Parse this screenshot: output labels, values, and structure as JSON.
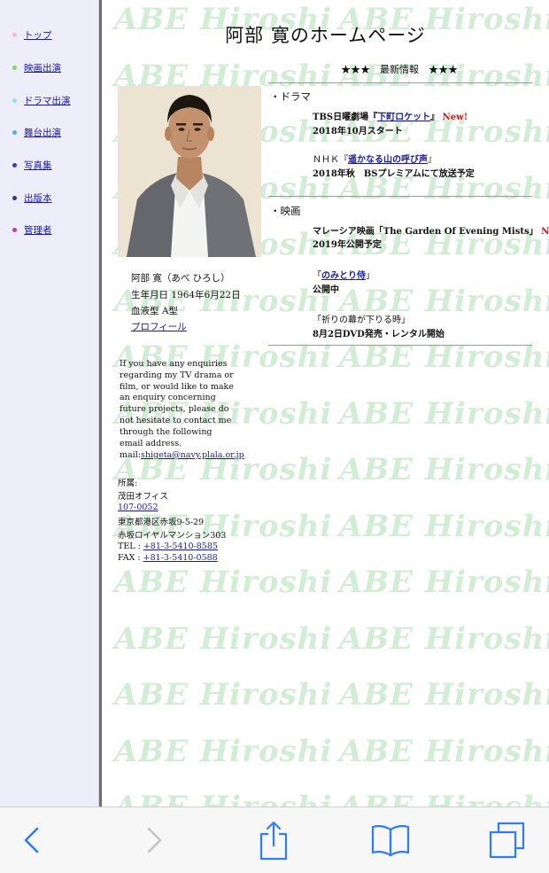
{
  "sidebar": {
    "items": [
      {
        "label": "トップ",
        "color": "#f3b9c8"
      },
      {
        "label": "映画出演",
        "color": "#7ed66a"
      },
      {
        "label": "ドラマ出演",
        "color": "#8fe3ea"
      },
      {
        "label": "舞台出演",
        "color": "#5aa7e6"
      },
      {
        "label": "写真集",
        "color": "#3a3fa8"
      },
      {
        "label": "出版本",
        "color": "#34309a"
      },
      {
        "label": "管理者",
        "color": "#b040c8"
      }
    ]
  },
  "watermark": {
    "text": "ABE Hiroshi",
    "color": "#d2ecd6"
  },
  "header": {
    "title": "阿部 寛のホームページ",
    "news_title": "★★★　最新情報　★★★"
  },
  "profile": {
    "name": "阿部 寛（あべ ひろし）",
    "birth": "生年月日 1964年6月22日",
    "blood": "血液型 A型",
    "link_label": "プロフィール"
  },
  "news": {
    "drama": {
      "heading": "・ドラマ",
      "item1_prefix": "TBS日曜劇場『",
      "item1_link": "下町ロケット",
      "item1_suffix": "』",
      "item1_badge": "New!",
      "item1_sub": "2018年10月スタート",
      "item2_prefix": "ＮＨＫ『",
      "item2_link": "遥かなる山の呼び声",
      "item2_suffix": "』",
      "item2_sub": "2018年秋　BSプレミアムにて放送予定"
    },
    "movie": {
      "heading": "・映画",
      "item1_prefix": "マレーシア映画「The Garden Of Evening Mists」",
      "item1_badge": "New!",
      "item1_sub": "2019年公開予定",
      "item2_prefix": "「",
      "item2_link": "のみとり侍",
      "item2_suffix": "」",
      "item2_sub": "公開中",
      "item3_title": "「祈りの幕が下りる時」",
      "item3_sub": "8月2日DVD発売・レンタル開始"
    }
  },
  "contact": {
    "enquiry": "If you have any enquiries regarding my TV drama or film, or would like to make an enquiry concerning future projects, please do not hesitate to contact me through the following email address.",
    "mail_prefix": "mail:",
    "mail_address": "shigeta@navy.plala.or.jp",
    "affiliation_label": "所属:",
    "office_name": "茂田オフィス",
    "postal_code": "107-0052",
    "address1": "東京都港区赤坂9-5-29",
    "address2": "赤坂ロイヤルマンション303",
    "tel_prefix": "TEL : ",
    "tel": "+81-3-5410-8585",
    "fax_prefix": "FAX : ",
    "fax": "+81-3-5410-0588"
  },
  "toolbar": {
    "icons": [
      "back-icon",
      "forward-icon",
      "share-icon",
      "bookmarks-icon",
      "tabs-icon"
    ],
    "accent": "#2f7cf6",
    "disabled": "#c4c4c8"
  }
}
